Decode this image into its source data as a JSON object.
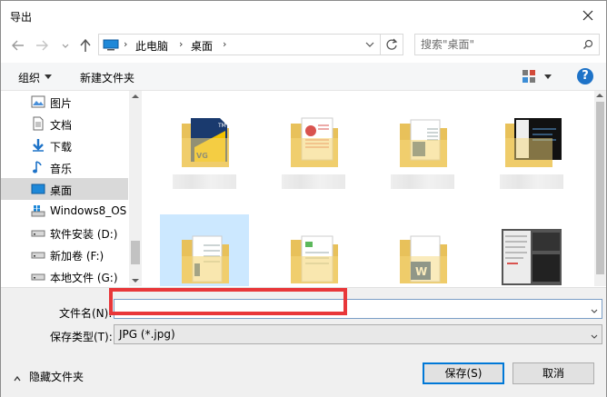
{
  "window": {
    "title": "导出"
  },
  "address": {
    "crumbs": [
      "此电脑",
      "桌面"
    ],
    "search_placeholder": "搜索\"桌面\""
  },
  "toolbar": {
    "organize": "组织",
    "new_folder": "新建文件夹",
    "help": "?"
  },
  "nav": {
    "items": [
      {
        "label": "图片",
        "icon": "pictures-icon"
      },
      {
        "label": "文档",
        "icon": "documents-icon"
      },
      {
        "label": "下载",
        "icon": "downloads-icon"
      },
      {
        "label": "音乐",
        "icon": "music-icon"
      },
      {
        "label": "桌面",
        "icon": "desktop-icon",
        "selected": true
      },
      {
        "label": "Windows8_OS",
        "icon": "drive-windows-icon"
      },
      {
        "label": "软件安装 (D:)",
        "icon": "drive-icon"
      },
      {
        "label": "新加卷 (F:)",
        "icon": "drive-icon"
      },
      {
        "label": "本地文件 (G:)",
        "icon": "drive-icon"
      }
    ]
  },
  "files": [
    {
      "kind": "folder-tm",
      "selected": false
    },
    {
      "kind": "folder-docs-red",
      "selected": false
    },
    {
      "kind": "folder-word",
      "selected": false
    },
    {
      "kind": "screenshot-dark",
      "selected": false
    },
    {
      "kind": "folder-word",
      "selected": true
    },
    {
      "kind": "folder-green-doc",
      "selected": false
    },
    {
      "kind": "folder-word",
      "selected": false
    },
    {
      "kind": "screenshot-app",
      "selected": false
    }
  ],
  "bottom": {
    "filename_label": "文件名(N):",
    "filename_value": "",
    "filetype_label": "保存类型(T):",
    "filetype_value": "JPG (*.jpg)",
    "hide_folders": "隐藏文件夹",
    "save_button": "保存(S)",
    "cancel_button": "取消"
  },
  "colors": {
    "accent": "#0078d7",
    "selection": "#cce8ff",
    "highlight_box": "#e8373a",
    "folder": "#f5d77a"
  }
}
